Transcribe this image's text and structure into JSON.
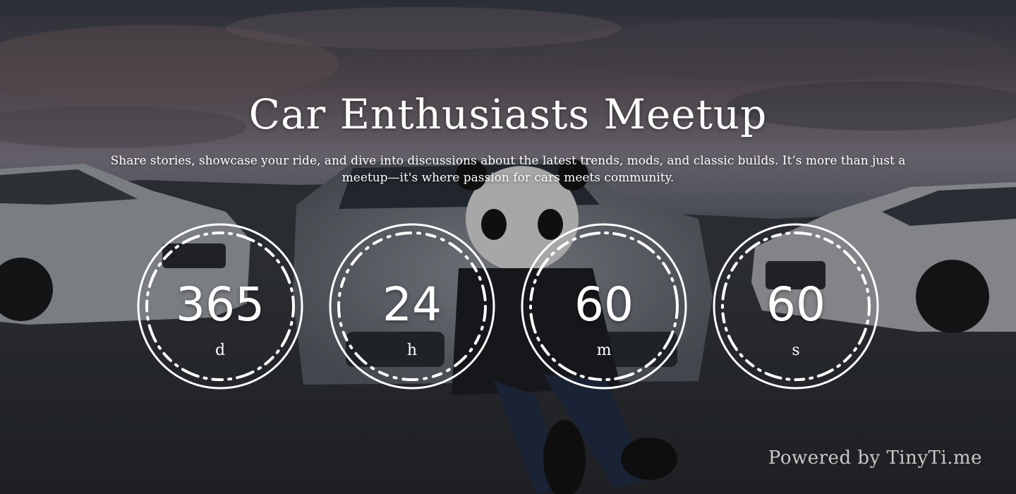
{
  "event": {
    "title": "Car Enthusiasts Meetup",
    "description": "Share stories, showcase your ride, and dive into discussions about the latest trends, mods, and classic builds. It’s more than just a meetup—it's where passion for cars meets community."
  },
  "countdown": [
    {
      "value": "365",
      "unit": "d"
    },
    {
      "value": "24",
      "unit": "h"
    },
    {
      "value": "60",
      "unit": "m"
    },
    {
      "value": "60",
      "unit": "s"
    }
  ],
  "footer": {
    "powered_by": "Powered by TinyTi.me"
  },
  "background": {
    "scene": "sunset parking lot with white sports cars and person in panda mask"
  }
}
